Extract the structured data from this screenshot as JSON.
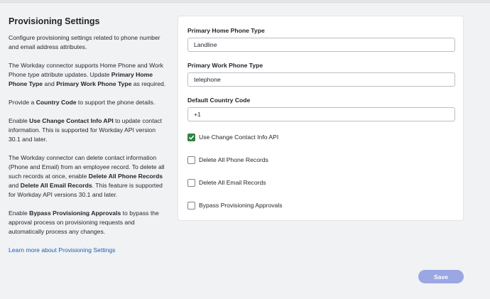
{
  "sidebar": {
    "title": "Provisioning Settings",
    "p1": "Configure provisioning settings related to phone number and email address attributes.",
    "p2_a": "The Workday connector supports Home Phone and Work Phone type attribute updates. Update ",
    "p2_b": "Primary Home Phone Type",
    "p2_c": " and ",
    "p2_d": "Primary Work Phone Type",
    "p2_e": " as required.",
    "p3_a": "Provide a ",
    "p3_b": "Country Code",
    "p3_c": " to support the phone details.",
    "p4_a": "Enable ",
    "p4_b": "Use Change Contact Info API",
    "p4_c": " to update contact information. This is supported for Workday API version 30.1 and later.",
    "p5_a": "The Workday connector can delete contact information (Phone and Email) from an employee record. To delete all such records at once, enable ",
    "p5_b": "Delete All Phone Records",
    "p5_c": " and ",
    "p5_d": "Delete All Email Records",
    "p5_e": ". This feature is supported for Workday API versions 30.1 and later.",
    "p6_a": "Enable ",
    "p6_b": "Bypass Provisioning Approvals",
    "p6_c": " to bypass the approval process on provisioning requests and automatically process any changes.",
    "learn_more": "Learn more about Provisioning Settings"
  },
  "form": {
    "home_phone_label": "Primary Home Phone Type",
    "home_phone_value": "Landline",
    "work_phone_label": "Primary Work Phone Type",
    "work_phone_value": "telephone",
    "country_code_label": "Default Country Code",
    "country_code_value": "+1",
    "checkboxes": [
      {
        "label": "Use Change Contact Info API",
        "checked": true
      },
      {
        "label": "Delete All Phone Records",
        "checked": false
      },
      {
        "label": "Delete All Email Records",
        "checked": false
      },
      {
        "label": "Bypass Provisioning Approvals",
        "checked": false
      }
    ]
  },
  "save_label": "Save",
  "colors": {
    "accent": "#2e8540",
    "link": "#1a5fb4",
    "save_bg": "#9aa7e3"
  }
}
